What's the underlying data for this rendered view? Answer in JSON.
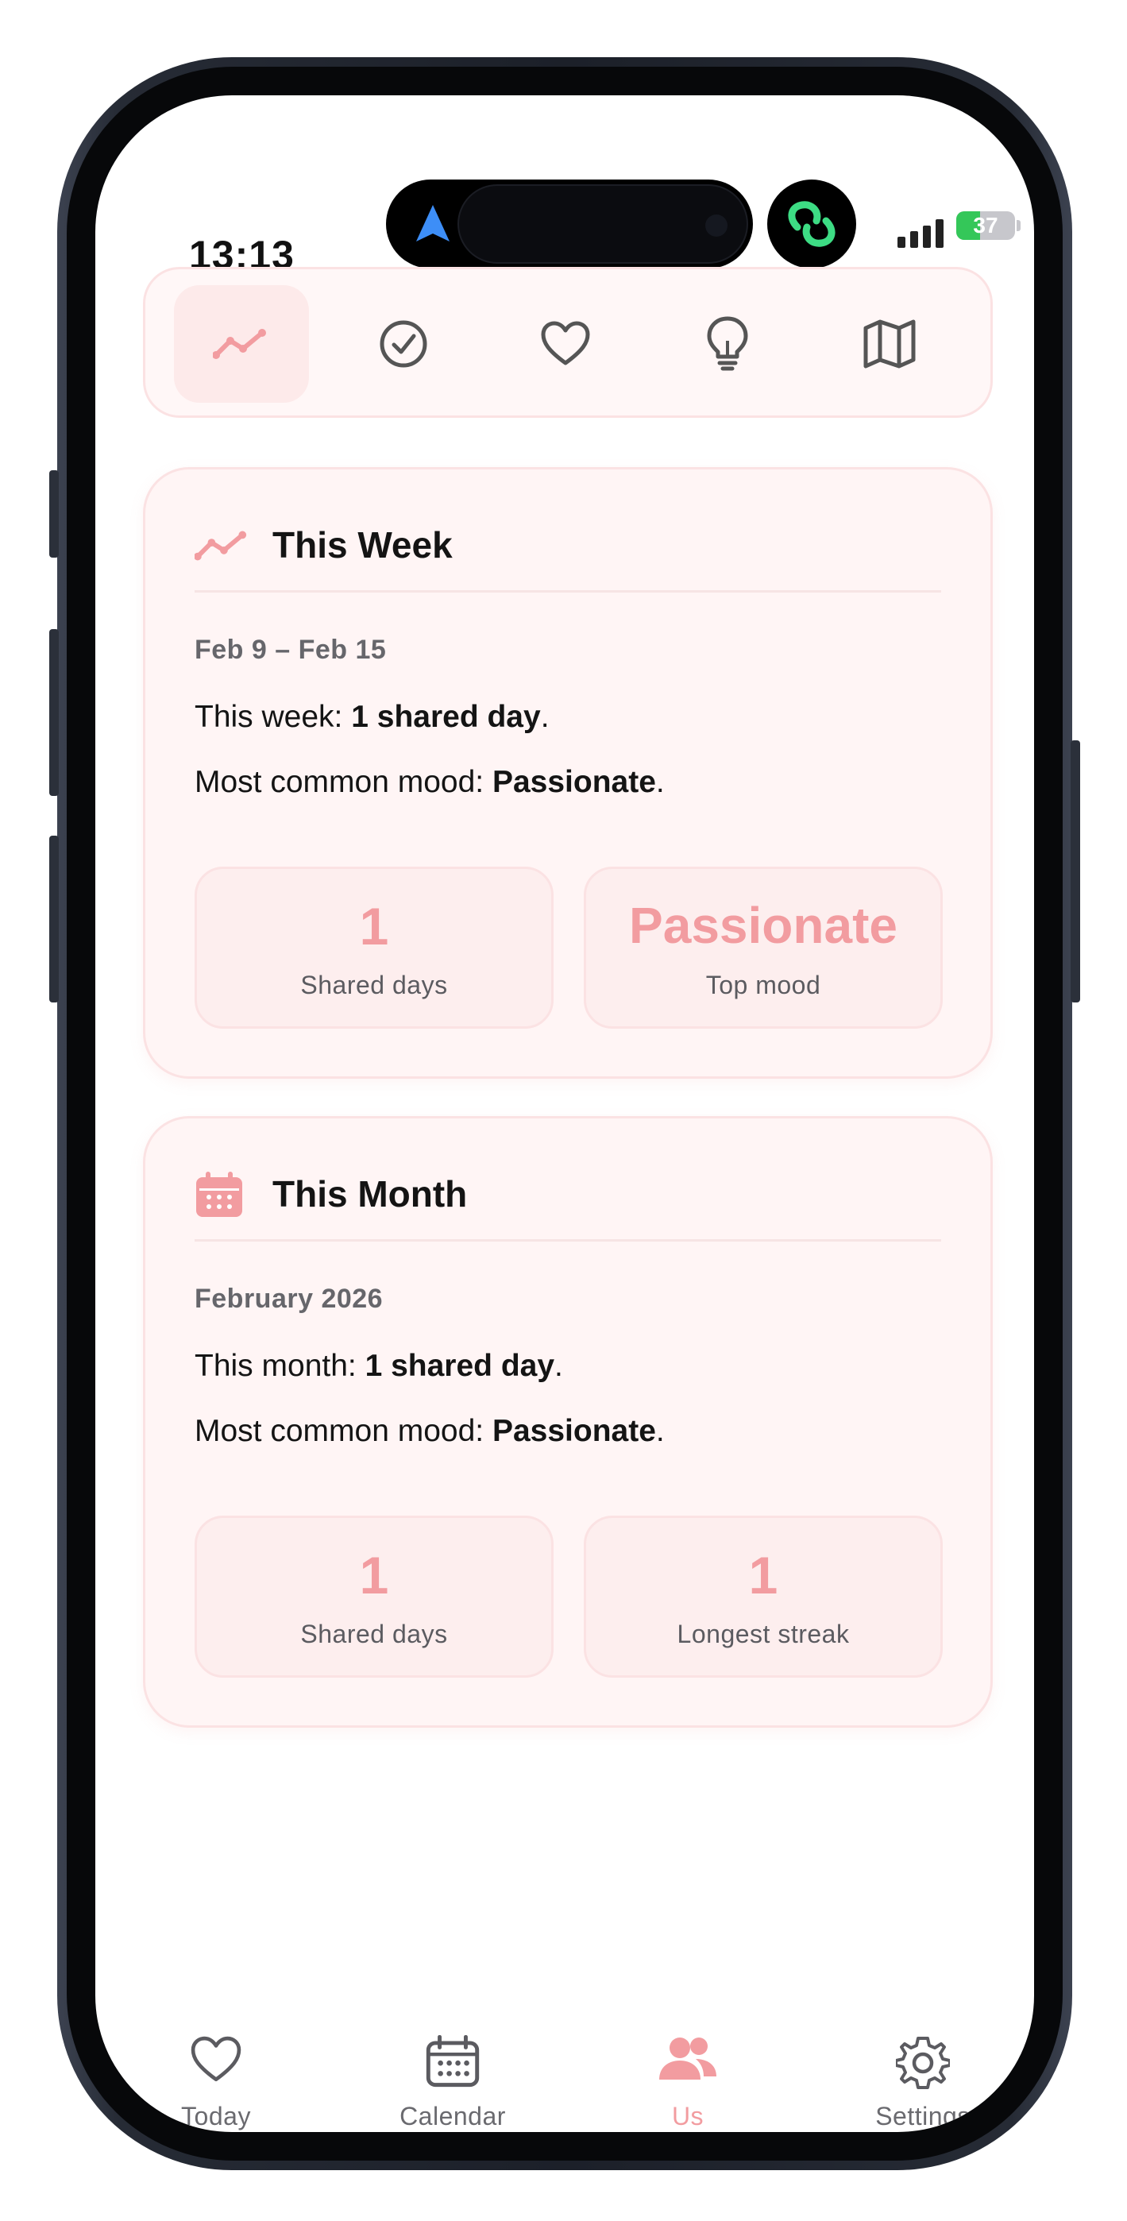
{
  "status_bar": {
    "time": "13:13",
    "battery": "37"
  },
  "top_tabs": [
    {
      "icon": "trend-line-icon",
      "active": true
    },
    {
      "icon": "check-circle-icon",
      "active": false
    },
    {
      "icon": "heart-icon",
      "active": false
    },
    {
      "icon": "lightbulb-icon",
      "active": false
    },
    {
      "icon": "map-icon",
      "active": false
    }
  ],
  "week_card": {
    "icon": "trend-line-icon",
    "title": "This Week",
    "range": "Feb 9 – Feb 15",
    "summary_prefix": "This week: ",
    "summary_bold": "1 shared day",
    "summary_suffix": ".",
    "mood_prefix": "Most common mood: ",
    "mood_bold": "Passionate",
    "mood_suffix": ".",
    "stats": [
      {
        "value": "1",
        "label": "Shared days"
      },
      {
        "value": "Passionate",
        "label": "Top mood"
      }
    ]
  },
  "month_card": {
    "icon": "calendar-icon",
    "title": "This Month",
    "range": "February 2026",
    "summary_prefix": "This month: ",
    "summary_bold": "1 shared day",
    "summary_suffix": ".",
    "mood_prefix": "Most common mood: ",
    "mood_bold": "Passionate",
    "mood_suffix": ".",
    "stats": [
      {
        "value": "1",
        "label": "Shared days"
      },
      {
        "value": "1",
        "label": "Longest streak"
      }
    ]
  },
  "bottom_nav": [
    {
      "label": "Today",
      "icon": "heart-icon",
      "active": false
    },
    {
      "label": "Calendar",
      "icon": "calendar-icon",
      "active": false
    },
    {
      "label": "Us",
      "icon": "people-icon",
      "active": true
    },
    {
      "label": "Settings",
      "icon": "gear-icon",
      "active": false
    }
  ],
  "colors": {
    "accent": "#f29ca0",
    "card_bg": "#fff5f5",
    "card_border": "#fbe2e3",
    "text": "#141414",
    "muted": "#66666b"
  }
}
